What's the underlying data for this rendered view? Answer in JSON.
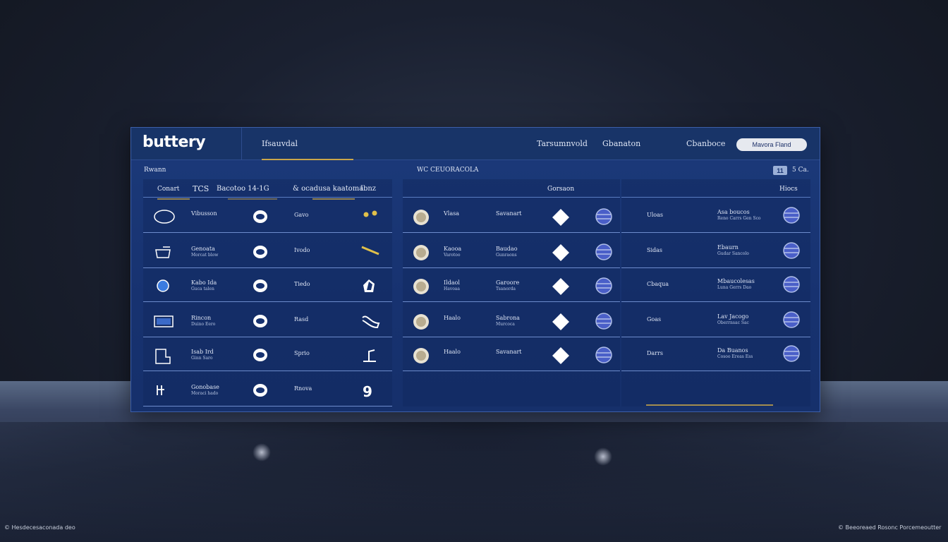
{
  "app": {
    "logo": "buttery",
    "tab_label": "Ifsauvdal",
    "nav_center": "Tarsumnvold",
    "nav_center_sub": "Gbanaton",
    "nav_right": "Cbanboce",
    "top_button": "Mavora Fland"
  },
  "subbar": {
    "left": "Rwann",
    "center": "WC CEUORACOLA",
    "badge": "11",
    "right": "5 Ca."
  },
  "columns": {
    "left_head": [
      "Conart",
      "TCS",
      "Bacotoo 14-1G",
      "& ocadusa kaatoma",
      "Ibnz"
    ],
    "mid_head": "Gorsaon",
    "right_head": "Hiocs"
  },
  "left_rows": [
    {
      "name": "Vibusson",
      "sub": "",
      "value": "Gavo",
      "icon": "ellipse-icon",
      "status_icon": "dots-icon"
    },
    {
      "name": "Genoata",
      "sub": "Morcat blow",
      "value": "Ivodo",
      "icon": "tray-icon",
      "status_icon": "slash-icon"
    },
    {
      "name": "Kabo Ida",
      "sub": "Guca talen",
      "value": "Tiedo",
      "icon": "blue-dot-icon",
      "status_icon": "shield-icon"
    },
    {
      "name": "Rincon",
      "sub": "Duino Eero",
      "value": "Rasd",
      "icon": "window-icon",
      "status_icon": "hook-icon"
    },
    {
      "name": "Isab Ird",
      "sub": "Ginn Saro",
      "value": "Sprio",
      "icon": "frame-icon",
      "status_icon": "flag-icon"
    },
    {
      "name": "Gonobase",
      "sub": "Moraci hado",
      "value": "Rnova",
      "icon": "plug-icon",
      "status_icon": "nine-icon"
    }
  ],
  "mid_rows": [
    {
      "name": "Vlasa",
      "sub": "",
      "value": "Savanart",
      "value_sub": ""
    },
    {
      "name": "Kaooa",
      "sub": "Varotoo",
      "value": "Baudao",
      "value_sub": "Gunraons"
    },
    {
      "name": "Ildaol",
      "sub": "Havoaa",
      "value": "Garoore",
      "value_sub": "Tsanorda"
    },
    {
      "name": "Haalo",
      "sub": "",
      "value": "Sabrona",
      "value_sub": "Murcoca"
    },
    {
      "name": "Haalo",
      "sub": "",
      "value": "Savanart",
      "value_sub": ""
    }
  ],
  "right_rows": [
    {
      "name": "Uloas",
      "detail": "Asa boucos",
      "detail_sub": "Reno Carrs  Gen Sco"
    },
    {
      "name": "Sidas",
      "detail": "Ebaurn",
      "detail_sub": "Gudar Sancolo"
    },
    {
      "name": "Cbaqua",
      "detail": "Mbaucolesas",
      "detail_sub": "Luna Gerrs  Dao"
    },
    {
      "name": "Goas",
      "detail": "Lav Jacogo",
      "detail_sub": "Oberrnsac  Sac"
    },
    {
      "name": "Darrs",
      "detail": "Da Buanos",
      "detail_sub": "Cosoo Ereas  Ess"
    }
  ],
  "footer": {
    "left": "© Hesdecesaconada deo",
    "right": "© Beeoreaed Rosonc Porcemeoutter"
  }
}
